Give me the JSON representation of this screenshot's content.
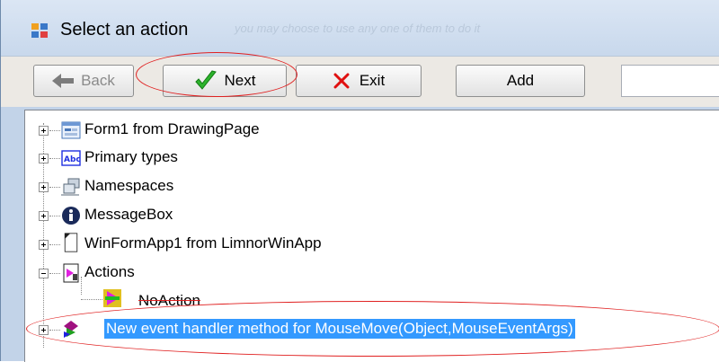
{
  "window": {
    "title": "Select an action",
    "title_ghost": "you may choose to use any one of them to do it"
  },
  "toolbar": {
    "back_label": "Back",
    "next_label": "Next",
    "exit_label": "Exit",
    "add_label": "Add",
    "search_value": ""
  },
  "tree": {
    "items": [
      {
        "label": "Form1 from DrawingPage",
        "icon": "form-icon"
      },
      {
        "label": "Primary types",
        "icon": "abc-icon"
      },
      {
        "label": "Namespaces",
        "icon": "namespace-icon"
      },
      {
        "label": "MessageBox",
        "icon": "info-icon"
      },
      {
        "label": "WinFormApp1 from LimnorWinApp",
        "icon": "page-icon"
      },
      {
        "label": "Actions",
        "icon": "actions-icon"
      },
      {
        "label": "NoAction",
        "icon": "no-action-icon"
      },
      {
        "label": "New event handler method for MouseMove(Object,MouseEventArgs)",
        "icon": "method-icon"
      }
    ]
  },
  "colors": {
    "selection": "#3399ff",
    "highlight_oval": "#e02020"
  }
}
